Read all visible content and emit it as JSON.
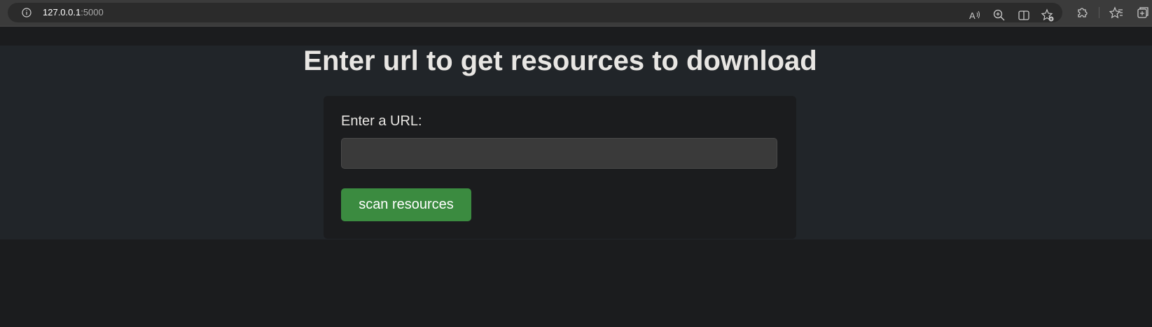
{
  "browser": {
    "url_host": "127.0.0.1",
    "url_port": ":5000",
    "icons": [
      "info-icon",
      "read-aloud-icon",
      "zoom-icon",
      "split-screen-icon",
      "add-favorite-icon",
      "extensions-icon",
      "favorites-icon",
      "collections-icon"
    ]
  },
  "page": {
    "title": "Enter url to get resources to download",
    "form": {
      "label": "Enter a URL:",
      "input_value": "",
      "button_label": "scan resources"
    }
  },
  "colors": {
    "page_background": "#1b1c1e",
    "band_background": "#212529",
    "button_green": "#3b8b40",
    "text": "#e8e6e3"
  }
}
